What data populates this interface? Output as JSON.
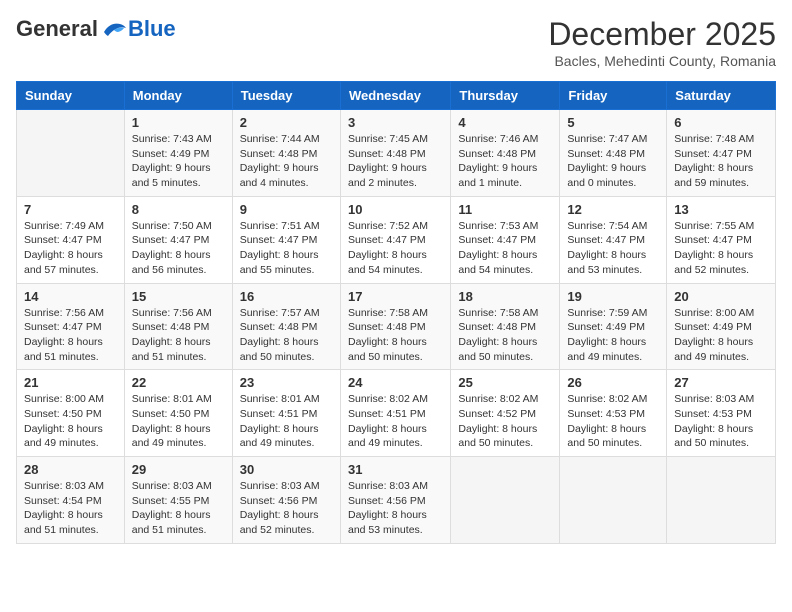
{
  "header": {
    "logo_general": "General",
    "logo_blue": "Blue",
    "month_title": "December 2025",
    "location": "Bacles, Mehedinti County, Romania"
  },
  "days_of_week": [
    "Sunday",
    "Monday",
    "Tuesday",
    "Wednesday",
    "Thursday",
    "Friday",
    "Saturday"
  ],
  "weeks": [
    [
      {
        "day": "",
        "info": ""
      },
      {
        "day": "1",
        "info": "Sunrise: 7:43 AM\nSunset: 4:49 PM\nDaylight: 9 hours\nand 5 minutes."
      },
      {
        "day": "2",
        "info": "Sunrise: 7:44 AM\nSunset: 4:48 PM\nDaylight: 9 hours\nand 4 minutes."
      },
      {
        "day": "3",
        "info": "Sunrise: 7:45 AM\nSunset: 4:48 PM\nDaylight: 9 hours\nand 2 minutes."
      },
      {
        "day": "4",
        "info": "Sunrise: 7:46 AM\nSunset: 4:48 PM\nDaylight: 9 hours\nand 1 minute."
      },
      {
        "day": "5",
        "info": "Sunrise: 7:47 AM\nSunset: 4:48 PM\nDaylight: 9 hours\nand 0 minutes."
      },
      {
        "day": "6",
        "info": "Sunrise: 7:48 AM\nSunset: 4:47 PM\nDaylight: 8 hours\nand 59 minutes."
      }
    ],
    [
      {
        "day": "7",
        "info": "Sunrise: 7:49 AM\nSunset: 4:47 PM\nDaylight: 8 hours\nand 57 minutes."
      },
      {
        "day": "8",
        "info": "Sunrise: 7:50 AM\nSunset: 4:47 PM\nDaylight: 8 hours\nand 56 minutes."
      },
      {
        "day": "9",
        "info": "Sunrise: 7:51 AM\nSunset: 4:47 PM\nDaylight: 8 hours\nand 55 minutes."
      },
      {
        "day": "10",
        "info": "Sunrise: 7:52 AM\nSunset: 4:47 PM\nDaylight: 8 hours\nand 54 minutes."
      },
      {
        "day": "11",
        "info": "Sunrise: 7:53 AM\nSunset: 4:47 PM\nDaylight: 8 hours\nand 54 minutes."
      },
      {
        "day": "12",
        "info": "Sunrise: 7:54 AM\nSunset: 4:47 PM\nDaylight: 8 hours\nand 53 minutes."
      },
      {
        "day": "13",
        "info": "Sunrise: 7:55 AM\nSunset: 4:47 PM\nDaylight: 8 hours\nand 52 minutes."
      }
    ],
    [
      {
        "day": "14",
        "info": "Sunrise: 7:56 AM\nSunset: 4:47 PM\nDaylight: 8 hours\nand 51 minutes."
      },
      {
        "day": "15",
        "info": "Sunrise: 7:56 AM\nSunset: 4:48 PM\nDaylight: 8 hours\nand 51 minutes."
      },
      {
        "day": "16",
        "info": "Sunrise: 7:57 AM\nSunset: 4:48 PM\nDaylight: 8 hours\nand 50 minutes."
      },
      {
        "day": "17",
        "info": "Sunrise: 7:58 AM\nSunset: 4:48 PM\nDaylight: 8 hours\nand 50 minutes."
      },
      {
        "day": "18",
        "info": "Sunrise: 7:58 AM\nSunset: 4:48 PM\nDaylight: 8 hours\nand 50 minutes."
      },
      {
        "day": "19",
        "info": "Sunrise: 7:59 AM\nSunset: 4:49 PM\nDaylight: 8 hours\nand 49 minutes."
      },
      {
        "day": "20",
        "info": "Sunrise: 8:00 AM\nSunset: 4:49 PM\nDaylight: 8 hours\nand 49 minutes."
      }
    ],
    [
      {
        "day": "21",
        "info": "Sunrise: 8:00 AM\nSunset: 4:50 PM\nDaylight: 8 hours\nand 49 minutes."
      },
      {
        "day": "22",
        "info": "Sunrise: 8:01 AM\nSunset: 4:50 PM\nDaylight: 8 hours\nand 49 minutes."
      },
      {
        "day": "23",
        "info": "Sunrise: 8:01 AM\nSunset: 4:51 PM\nDaylight: 8 hours\nand 49 minutes."
      },
      {
        "day": "24",
        "info": "Sunrise: 8:02 AM\nSunset: 4:51 PM\nDaylight: 8 hours\nand 49 minutes."
      },
      {
        "day": "25",
        "info": "Sunrise: 8:02 AM\nSunset: 4:52 PM\nDaylight: 8 hours\nand 50 minutes."
      },
      {
        "day": "26",
        "info": "Sunrise: 8:02 AM\nSunset: 4:53 PM\nDaylight: 8 hours\nand 50 minutes."
      },
      {
        "day": "27",
        "info": "Sunrise: 8:03 AM\nSunset: 4:53 PM\nDaylight: 8 hours\nand 50 minutes."
      }
    ],
    [
      {
        "day": "28",
        "info": "Sunrise: 8:03 AM\nSunset: 4:54 PM\nDaylight: 8 hours\nand 51 minutes."
      },
      {
        "day": "29",
        "info": "Sunrise: 8:03 AM\nSunset: 4:55 PM\nDaylight: 8 hours\nand 51 minutes."
      },
      {
        "day": "30",
        "info": "Sunrise: 8:03 AM\nSunset: 4:56 PM\nDaylight: 8 hours\nand 52 minutes."
      },
      {
        "day": "31",
        "info": "Sunrise: 8:03 AM\nSunset: 4:56 PM\nDaylight: 8 hours\nand 53 minutes."
      },
      {
        "day": "",
        "info": ""
      },
      {
        "day": "",
        "info": ""
      },
      {
        "day": "",
        "info": ""
      }
    ]
  ]
}
